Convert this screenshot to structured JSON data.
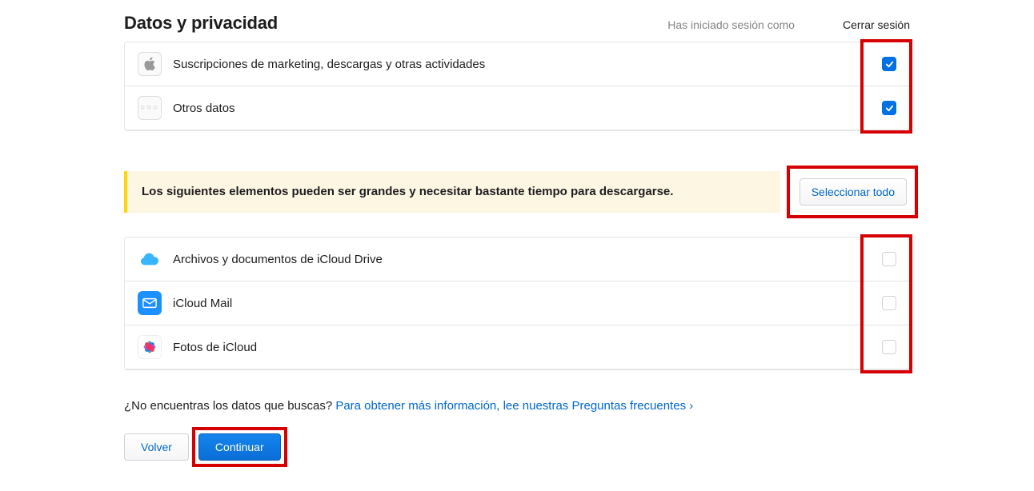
{
  "header": {
    "title": "Datos y privacidad",
    "signed_in_label": "Has iniciado sesión como",
    "signout_label": "Cerrar sesión"
  },
  "section1": {
    "items": [
      {
        "label": "Suscripciones de marketing, descargas y otras actividades",
        "checked": true,
        "icon": "apple"
      },
      {
        "label": "Otros datos",
        "checked": true,
        "icon": "dots"
      }
    ]
  },
  "notice": {
    "text": "Los siguientes elementos pueden ser grandes y necesitar bastante tiempo para descargarse."
  },
  "select_all_label": "Seleccionar todo",
  "section2": {
    "items": [
      {
        "label": "Archivos y documentos de iCloud Drive",
        "checked": false,
        "icon": "icloud-drive"
      },
      {
        "label": "iCloud Mail",
        "checked": false,
        "icon": "mail"
      },
      {
        "label": "Fotos de iCloud",
        "checked": false,
        "icon": "photos"
      }
    ]
  },
  "faq": {
    "prefix": "¿No encuentras los datos que buscas? ",
    "link_text": "Para obtener más información, lee nuestras Preguntas frecuentes ›"
  },
  "buttons": {
    "back": "Volver",
    "continue": "Continuar"
  }
}
